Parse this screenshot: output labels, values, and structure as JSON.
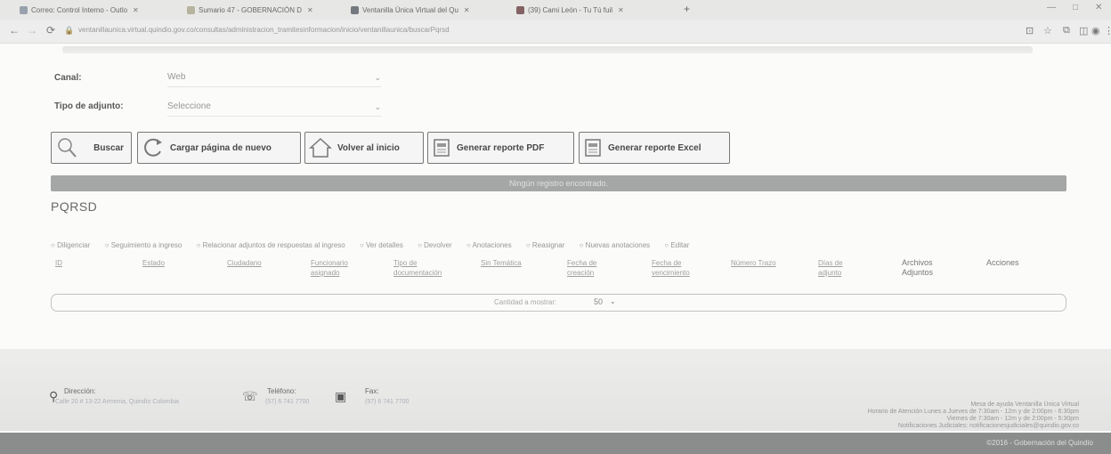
{
  "browser": {
    "tabs": [
      {
        "title": "Correo: Control Interno - Outlo"
      },
      {
        "title": "Sumario 47 - GOBERNACIÓN D"
      },
      {
        "title": "Ventanilla Única Virtual del Qu"
      },
      {
        "title": "(39) Cami León - Tu Tú fuil"
      }
    ],
    "new_tab": "+",
    "url": "ventanillaunica.virtual.quindio.gov.co/consultas/administracion_tramitesinformacion/inicio/ventanillaunica/buscarPqrsd",
    "window_controls": [
      "—",
      "□",
      "✕"
    ]
  },
  "form": {
    "canal_label": "Canal:",
    "canal_value": "Web",
    "tipo_label": "Tipo de adjunto:",
    "tipo_value": "Seleccione"
  },
  "buttons": {
    "buscar": "Buscar",
    "cargar": "Cargar página de nuevo",
    "volver": "Volver al inicio",
    "pdf": "Generar reporte PDF",
    "excel": "Generar reporte Excel"
  },
  "banner": "Ningún registro encontrado.",
  "section_title": "PQRSD",
  "legend": [
    "Diligenciar",
    "Seguimiento a ingreso",
    "Relacionar adjuntos de respuestas al ingreso",
    "Ver detalles",
    "Devolver",
    "Anotaciones",
    "Reasignar",
    "Nuevas anotaciones",
    "Editar"
  ],
  "table": {
    "columns": [
      {
        "label": "ID"
      },
      {
        "label": "Estado"
      },
      {
        "label": "Ciudadano"
      },
      {
        "label": "Funcionario asignado"
      },
      {
        "label": "Tipo de documentación"
      },
      {
        "label": "Sin Temática"
      },
      {
        "label": "Fecha de creación"
      },
      {
        "label": "Fecha de vencimiento"
      },
      {
        "label": "Número Trazo"
      },
      {
        "label": "Días de adjunto"
      },
      {
        "label": "Archivos Adjuntos"
      },
      {
        "label": "Acciones"
      }
    ]
  },
  "pager": {
    "label": "Cantidad a mostrar:",
    "value": "50"
  },
  "footer": {
    "direccion_label": "Dirección:",
    "direccion_value": "Calle 20 # 13-22 Armenia, Quindío Colombia",
    "telefono_label": "Teléfono:",
    "telefono_value": "(57) 6 741 7700",
    "fax_label": "Fax:",
    "fax_value": "(57) 6 741 7700",
    "info_lines": [
      "Mesa de ayuda Ventanilla Única Virtual",
      "Horario de Atención Lunes a Jueves de 7:30am - 12m y de 2:00pm - 6:30pm",
      "Viernes de 7:30am - 12m y de 2:00pm - 5:30pm",
      "Notificaciones Judiciales: notificacionesjudiciales@quindio.gov.co"
    ],
    "bottom_text": "©2016 - Gobernación del Quindío"
  }
}
